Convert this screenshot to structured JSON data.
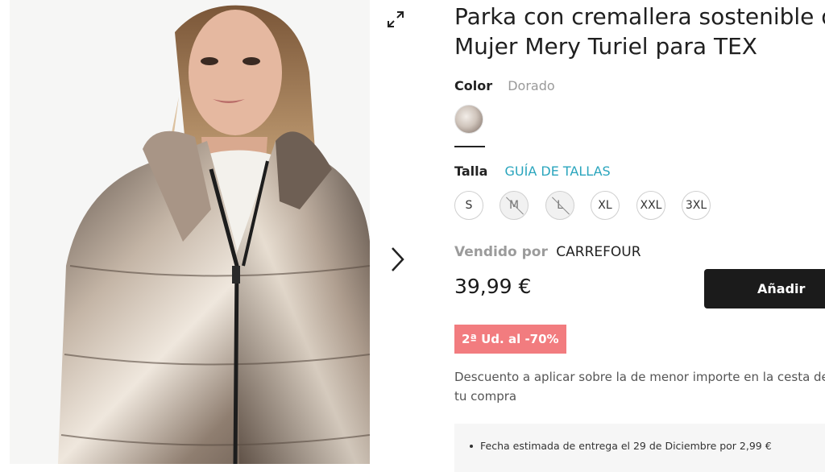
{
  "product": {
    "title_line1": "Parka con cremallera sostenible de",
    "title_line2": "Mujer Mery Turiel para TEX"
  },
  "color": {
    "label": "Color",
    "value": "Dorado"
  },
  "size": {
    "label": "Talla",
    "guide_link": "GUÍA DE TALLAS",
    "options": [
      {
        "label": "S",
        "available": true
      },
      {
        "label": "M",
        "available": false
      },
      {
        "label": "L",
        "available": false
      },
      {
        "label": "XL",
        "available": true
      },
      {
        "label": "XXL",
        "available": true
      },
      {
        "label": "3XL",
        "available": true
      }
    ]
  },
  "seller": {
    "label": "Vendido por",
    "name": "CARREFOUR"
  },
  "price": "39,99 €",
  "add_button": "Añadir",
  "promo_badge": "2ª Ud. al -70%",
  "discount_line1": "Descuento a aplicar sobre la de menor importe en la cesta de",
  "discount_line2": "tu compra",
  "delivery": {
    "text": "Fecha estimada de entrega el 29 de Diciembre por 2,99 €"
  },
  "icons": {
    "expand": "expand-icon",
    "next": "chevron-right-icon"
  },
  "colors": {
    "button": "#1b1b1b",
    "promo": "#f27c7f",
    "link": "#2aa5bd"
  }
}
